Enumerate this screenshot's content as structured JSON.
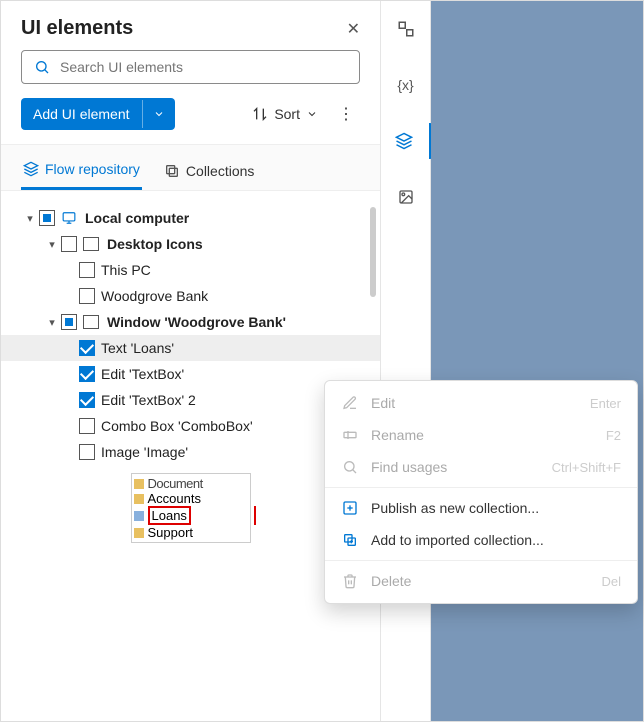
{
  "header": {
    "title": "UI elements"
  },
  "search": {
    "placeholder": "Search UI elements"
  },
  "toolbar": {
    "add_label": "Add UI element",
    "sort_label": "Sort"
  },
  "tabs": {
    "flow": "Flow repository",
    "collections": "Collections"
  },
  "tree": {
    "local": "Local computer",
    "desktop": "Desktop Icons",
    "thispc": "This PC",
    "woodgrove": "Woodgrove Bank",
    "window": "Window 'Woodgrove Bank'",
    "text_loans": "Text 'Loans'",
    "edit_tb": "Edit 'TextBox'",
    "edit_tb2": "Edit 'TextBox' 2",
    "combo": "Combo Box 'ComboBox'",
    "image": "Image 'Image'"
  },
  "preview": {
    "r1": "Document",
    "r2": "Accounts",
    "r3": "Loans",
    "r4": "Support"
  },
  "ctx": {
    "edit": "Edit",
    "edit_sc": "Enter",
    "rename": "Rename",
    "rename_sc": "F2",
    "find": "Find usages",
    "find_sc": "Ctrl+Shift+F",
    "publish": "Publish as new collection...",
    "addto": "Add to imported collection...",
    "delete": "Delete",
    "delete_sc": "Del"
  }
}
